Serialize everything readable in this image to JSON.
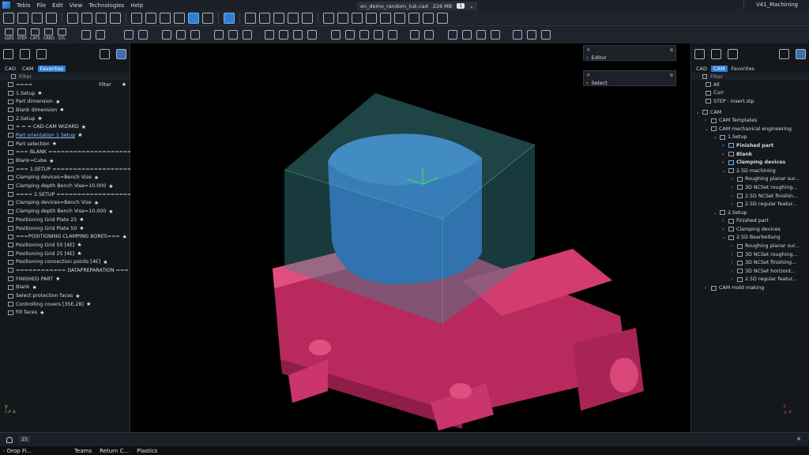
{
  "menubar": {
    "items": [
      "Tebis",
      "File",
      "Edit",
      "View",
      "Technologies",
      "Help"
    ],
    "doc_tab": {
      "filename": "en_demo_random_tuk.cad",
      "memory": "226 MB",
      "badge": "1"
    },
    "window_title": "V41_Machining"
  },
  "toolbar2": {
    "labels": [
      "IGES",
      "STEP",
      "CATS",
      "CREO",
      "STL"
    ]
  },
  "left_panel": {
    "tabs": [
      "CAD",
      "CAM",
      "Favorites"
    ],
    "active_tab": "Favorites",
    "filter_label": "Filter",
    "rows": [
      {
        "text": "====",
        "right": "Filter",
        "star": true
      },
      {
        "text": "1.Setup",
        "star": true
      },
      {
        "text": "Part dimension",
        "star": true
      },
      {
        "text": "Blank dimension",
        "star": true
      },
      {
        "text": "2.Setup",
        "star": true
      },
      {
        "text": "= = =        CAD-CAM WIZARD",
        "star": true
      },
      {
        "text": "Part orientation 1 Setup",
        "link": true,
        "star": true
      },
      {
        "text": "Part selection",
        "star": true
      },
      {
        "text": "=== BLANK ==========================",
        "star": true
      },
      {
        "text": "Blank=Cube",
        "star": true
      },
      {
        "text": "=== 1.SETUP ==========================",
        "star": true
      },
      {
        "text": "Clamping devices=Bench Vise",
        "star": true
      },
      {
        "text": "Clamping depth Bench Vise=10.000",
        "star": true
      },
      {
        "text": "==== 2.SETUP =========================",
        "star": true
      },
      {
        "text": "Clamping devices=Bench Vise",
        "star": true
      },
      {
        "text": "Clamping depth Bench Vise=10.000",
        "star": true
      },
      {
        "text": "Positioning Grid Plate 25",
        "star": true
      },
      {
        "text": "Positioning Grid Plate 50",
        "star": true
      },
      {
        "text": "===POSITIONING CLAMPING BORES===",
        "star": true
      },
      {
        "text": "Positioning Grid 50 [4E]",
        "star": true
      },
      {
        "text": "Positioning Grid 25 [4E]",
        "star": true
      },
      {
        "text": "Positioning  connection points [4E]",
        "star": true
      },
      {
        "text": "============     DATAPREPARATION     ===",
        "star": true
      },
      {
        "text": "FINISHED PART",
        "star": true
      },
      {
        "text": "Blank",
        "star": true
      },
      {
        "text": "Select protection faces",
        "star": true
      },
      {
        "text": "Controlling covers [35E,28]",
        "star": true
      },
      {
        "text": "Fill faces",
        "star": true
      }
    ]
  },
  "viewport": {
    "editor_label": "Editor",
    "select_label": "Select"
  },
  "right_panel": {
    "tabs": [
      "CAD",
      "CAM",
      "Favorites"
    ],
    "active_tab": "CAM",
    "filter_label": "Filter",
    "top_rows": [
      "All",
      "Curr",
      "STEP : insert.stp"
    ],
    "tree": [
      {
        "depth": 0,
        "chev": "v",
        "text": "CAM",
        "blue": false
      },
      {
        "depth": 1,
        "chev": ">",
        "text": "CAM Templates"
      },
      {
        "depth": 1,
        "chev": "v",
        "text": "CAM mechanical engineering"
      },
      {
        "depth": 2,
        "chev": "v",
        "text": "1.Setup"
      },
      {
        "depth": 3,
        "chev": ">",
        "text": "Finished part",
        "bold": true,
        "blue": true
      },
      {
        "depth": 3,
        "chev": ">",
        "text": "Blank",
        "bold": true
      },
      {
        "depth": 3,
        "chev": ">",
        "text": "Clamping devices",
        "bold": true,
        "blue": true
      },
      {
        "depth": 3,
        "chev": "v",
        "text": "2.5D machining"
      },
      {
        "depth": 4,
        "chev": ">",
        "text": "Roughing planar sur..."
      },
      {
        "depth": 4,
        "chev": ">",
        "text": "3D NCSet roughing..."
      },
      {
        "depth": 4,
        "chev": ">",
        "text": "2.5D NCSet finishin..."
      },
      {
        "depth": 4,
        "chev": ">",
        "text": "2.5D regular featur..."
      },
      {
        "depth": 2,
        "chev": "v",
        "text": "2.Setup"
      },
      {
        "depth": 3,
        "chev": ">",
        "text": "Finished part"
      },
      {
        "depth": 3,
        "chev": ">",
        "text": "Clamping devices"
      },
      {
        "depth": 3,
        "chev": "v",
        "text": "2.5D Bearbeitung"
      },
      {
        "depth": 4,
        "chev": ">",
        "text": "Roughing planar sur..."
      },
      {
        "depth": 4,
        "chev": ">",
        "text": "3D NCSet roughing..."
      },
      {
        "depth": 4,
        "chev": ">",
        "text": "3D NCSet finishing..."
      },
      {
        "depth": 4,
        "chev": ">",
        "text": "3D NCSet horizont..."
      },
      {
        "depth": 4,
        "chev": ">",
        "text": "2.5D regular featur..."
      },
      {
        "depth": 1,
        "chev": ">",
        "text": "CAM mold making"
      }
    ]
  },
  "statusbar": {
    "notification_count": "25"
  },
  "taskbar": {
    "items": [
      "Drop Fi...",
      "Teams",
      "Return C...",
      "Plastics"
    ]
  },
  "colors": {
    "accent": "#2f7fd4",
    "part": "#2a63c6",
    "blank": "#3a8a8f",
    "vise": "#c9356c"
  }
}
